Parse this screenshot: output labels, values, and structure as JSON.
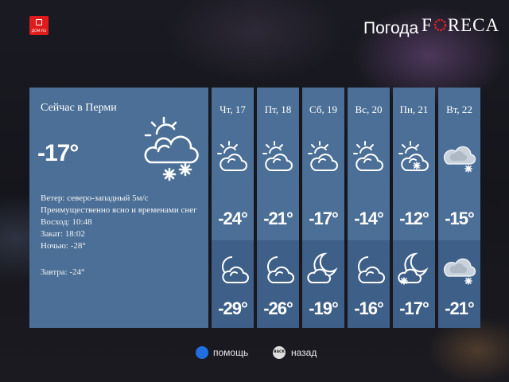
{
  "header": {
    "brand_text": "ДОМ.RU",
    "title": "Погода",
    "provider_letter_f": "F",
    "provider_rest": "RECA"
  },
  "current": {
    "city_label": "Сейчас в Перми",
    "temp": "-17°",
    "icon": "partly-cloudy-snow-icon",
    "details": {
      "wind": "Ветер: северо-западный 5м/с",
      "condition": "Преимущественно ясно и временами снег",
      "sunrise": "Восход: 10:48",
      "sunset": "Закат: 18:02",
      "night": "Ночью: -28°",
      "tomorrow": "Завтра: -24°"
    }
  },
  "forecast": [
    {
      "day": "Чт, 17",
      "day_temp": "-24°",
      "day_icon": "sun-cloud-icon",
      "night_temp": "-29°",
      "night_icon": "moon-cloud-icon"
    },
    {
      "day": "Пт, 18",
      "day_temp": "-21°",
      "day_icon": "sun-cloud-icon",
      "night_temp": "-26°",
      "night_icon": "moon-cloud-icon"
    },
    {
      "day": "Сб, 19",
      "day_temp": "-17°",
      "day_icon": "sun-cloud-icon",
      "night_temp": "-19°",
      "night_icon": "crescent-moon-cloud-icon"
    },
    {
      "day": "Вс, 20",
      "day_temp": "-14°",
      "day_icon": "sun-cloud-icon",
      "night_temp": "-16°",
      "night_icon": "moon-cloud-icon"
    },
    {
      "day": "Пн, 21",
      "day_temp": "-12°",
      "day_icon": "sun-cloud-snow-icon",
      "night_temp": "-17°",
      "night_icon": "crescent-moon-cloud-snow-icon"
    },
    {
      "day": "Вт, 22",
      "day_temp": "-15°",
      "day_icon": "cloud-snow-icon",
      "night_temp": "-21°",
      "night_icon": "cloud-snow-icon"
    }
  ],
  "footer": {
    "help_label": "помощь",
    "back_key": "BACK",
    "back_label": "назад",
    "help_color": "#1f6fe0"
  },
  "colors": {
    "panel": "#4b6f96",
    "night_panel": "#3e5f88",
    "brand_red": "#e01b1b",
    "foreca_accent": "#d8232a"
  }
}
